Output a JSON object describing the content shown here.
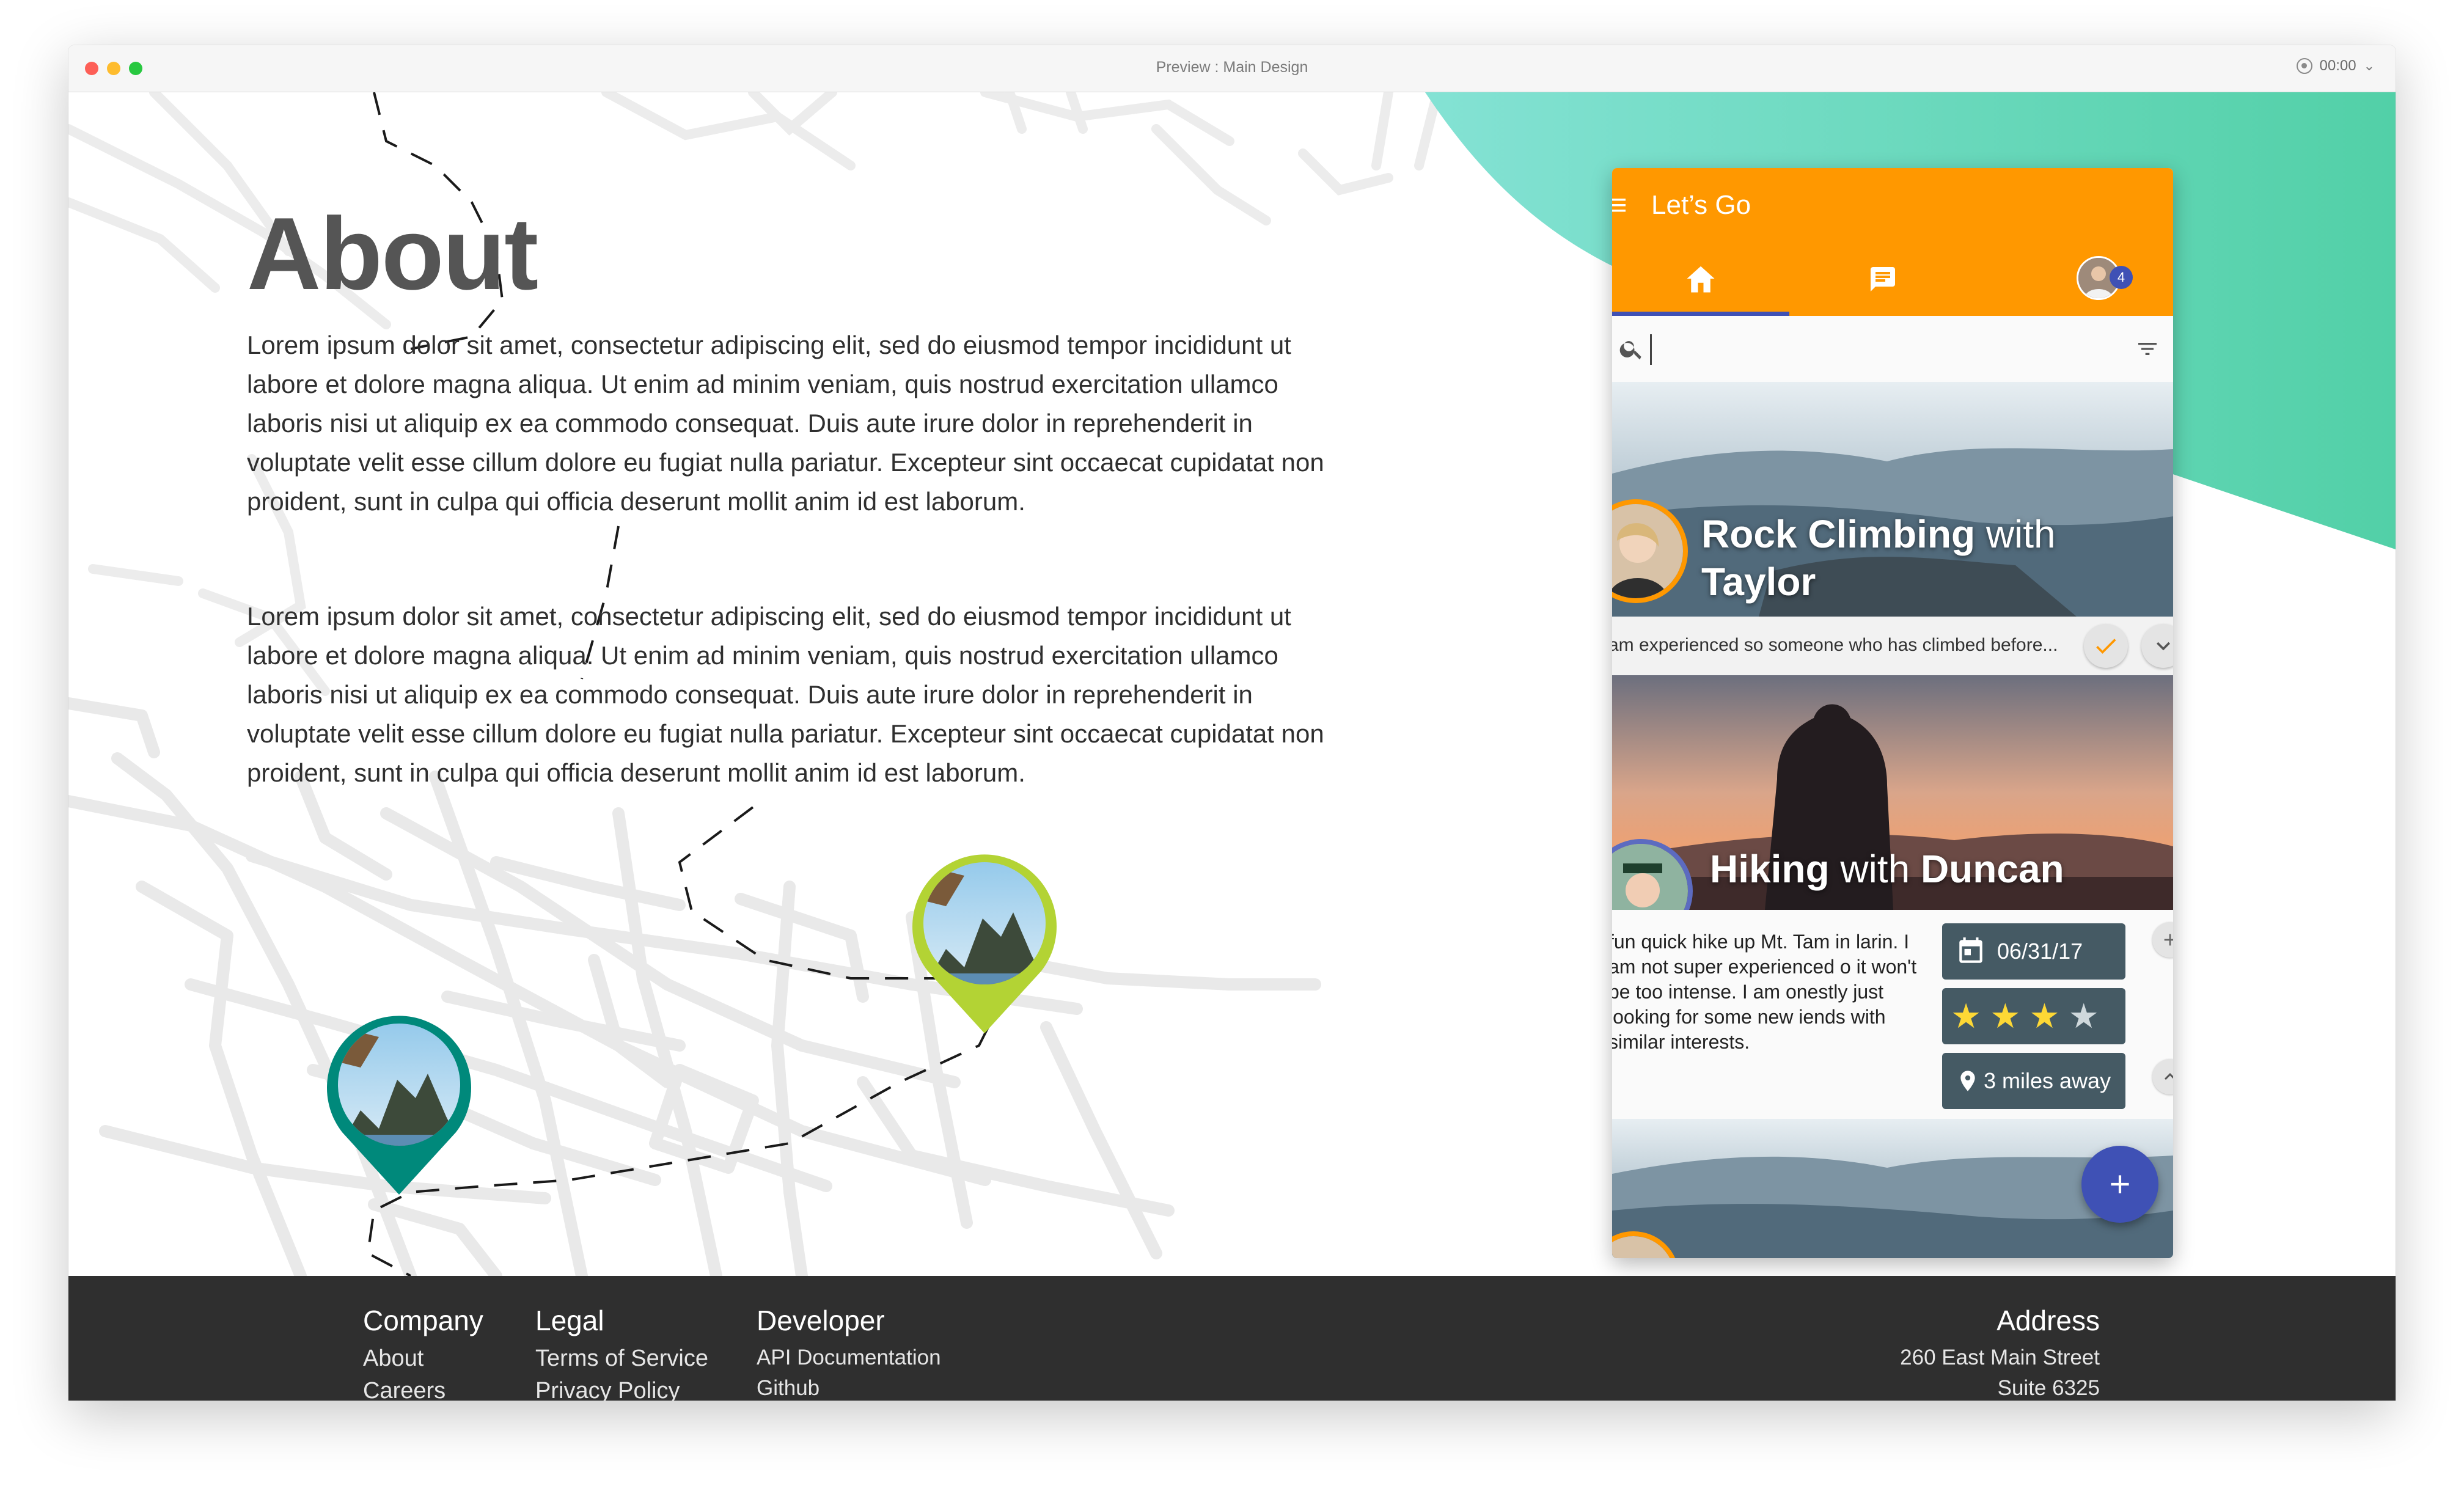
{
  "window": {
    "title": "Preview : Main Design",
    "timer": "00:00"
  },
  "page": {
    "heading": "About",
    "paragraphs": [
      "Lorem ipsum dolor sit amet, consectetur adipiscing elit, sed do eiusmod tempor incididunt ut labore et dolore magna aliqua. Ut enim ad minim veniam, quis nostrud exercitation ullamco laboris nisi ut aliquip ex ea commodo consequat. Duis aute irure dolor in reprehenderit in voluptate velit esse cillum dolore eu fugiat nulla pariatur. Excepteur sint occaecat cupidatat non proident, sunt in culpa qui officia deserunt mollit anim id est laborum.",
      "Lorem ipsum dolor sit amet, consectetur adipiscing elit, sed do eiusmod tempor incididunt ut labore et dolore magna aliqua. Ut enim ad minim veniam, quis nostrud exercitation ullamco laboris nisi ut aliquip ex ea commodo consequat. Duis aute irure dolor in reprehenderit in voluptate velit esse cillum dolore eu fugiat nulla pariatur. Excepteur sint occaecat cupidatat non proident, sunt in culpa qui officia deserunt mollit anim id est laborum."
    ]
  },
  "app": {
    "title": "Let’s Go",
    "badge_count": "4",
    "search_value": "",
    "cards": [
      {
        "title_bold_1": "Rock Climbing",
        "title_light": " with ",
        "title_bold_2": "Taylor",
        "snippet": "am experienced so someone who has climbed before..."
      },
      {
        "title_bold_1": "Hiking",
        "title_light": " with ",
        "title_bold_2": "Duncan",
        "description": "fun quick hike up Mt. Tam in larin. I am not super experienced o it won't be too intense. I am onestly just looking for some new iends with similar interests.",
        "date": "06/31/17",
        "rating": 3,
        "rating_max": 4,
        "distance": "3 miles away"
      }
    ]
  },
  "footer": {
    "company": {
      "heading": "Company",
      "links": [
        "About",
        "Careers"
      ]
    },
    "legal": {
      "heading": "Legal",
      "links": [
        "Terms of Service",
        "Privacy Policy"
      ]
    },
    "developer": {
      "heading": "Developer",
      "links": [
        "API Documentation",
        "Github"
      ]
    },
    "address": {
      "heading": "Address",
      "lines": [
        "260 East Main Street",
        "Suite 6325"
      ]
    }
  },
  "colors": {
    "appbar": "#ff9800",
    "accent": "#3f51b5",
    "teal_bg": "#5fd6b8",
    "pin_teal": "#009688",
    "pin_green": "#b3d334",
    "footer_bg": "#2f2f2f"
  },
  "icons": {
    "menu": "menu-icon",
    "home": "home-icon",
    "chat": "chat-icon",
    "search": "search-icon",
    "filter": "filter-icon",
    "check": "check-icon",
    "expand": "chevron-down-icon",
    "calendar": "calendar-icon",
    "location": "location-pin-icon",
    "add": "plus-icon"
  }
}
